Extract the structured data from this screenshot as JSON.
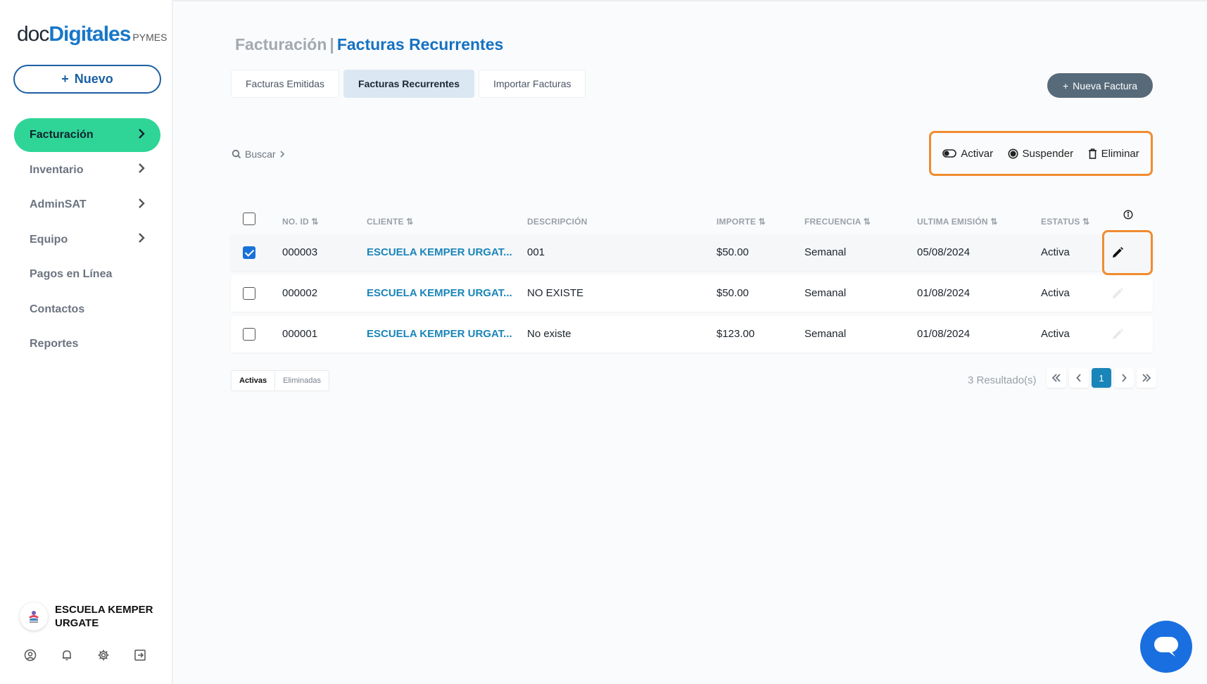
{
  "brand": {
    "doc": "doc",
    "digitales": "Digitales",
    "pymes": "PYMES"
  },
  "sidebar": {
    "new_label": "Nuevo",
    "items": [
      {
        "label": "Facturación",
        "chevron": true,
        "active": true
      },
      {
        "label": "Inventario",
        "chevron": true
      },
      {
        "label": "AdminSAT",
        "chevron": true
      },
      {
        "label": "Equipo",
        "chevron": true
      },
      {
        "label": "Pagos en Línea",
        "chevron": false
      },
      {
        "label": "Contactos",
        "chevron": false
      },
      {
        "label": "Reportes",
        "chevron": false
      }
    ],
    "user_name": "ESCUELA KEMPER URGATE",
    "bottom_icons": [
      "user-circle-icon",
      "bell-icon",
      "gear-icon",
      "logout-icon"
    ]
  },
  "header": {
    "section": "Facturación",
    "separator": "|",
    "page": "Facturas Recurrentes"
  },
  "tabs": [
    {
      "label": "Facturas Emitidas"
    },
    {
      "label": "Facturas Recurrentes",
      "active": true
    },
    {
      "label": "Importar Facturas"
    }
  ],
  "new_invoice_label": "Nueva Factura",
  "search_label": "Buscar",
  "actions": {
    "activate": "Activar",
    "suspend": "Suspender",
    "delete": "Eliminar"
  },
  "table": {
    "columns": [
      "NO. ID",
      "CLIENTE",
      "DESCRIPCIÓN",
      "IMPORTE",
      "FRECUENCIA",
      "ULTIMA EMISIÓN",
      "ESTATUS"
    ],
    "rows": [
      {
        "checked": true,
        "id": "000003",
        "client": "ESCUELA KEMPER URGAT...",
        "description": "001",
        "amount": "$50.00",
        "frequency": "Semanal",
        "last_issue": "05/08/2024",
        "status": "Activa"
      },
      {
        "checked": false,
        "id": "000002",
        "client": "ESCUELA KEMPER URGAT...",
        "description": "NO EXISTE",
        "amount": "$50.00",
        "frequency": "Semanal",
        "last_issue": "01/08/2024",
        "status": "Activa"
      },
      {
        "checked": false,
        "id": "000001",
        "client": "ESCUELA KEMPER URGAT...",
        "description": "No existe",
        "amount": "$123.00",
        "frequency": "Semanal",
        "last_issue": "01/08/2024",
        "status": "Activa"
      }
    ]
  },
  "footer": {
    "filters": [
      "Activas",
      "Eliminadas"
    ],
    "results": "3 Resultado(s)",
    "current_page": "1"
  },
  "colors": {
    "accent_green": "#2ed596",
    "brand_blue": "#1671c2",
    "highlight_orange": "#f08c30",
    "link_blue": "#1a85b8"
  }
}
